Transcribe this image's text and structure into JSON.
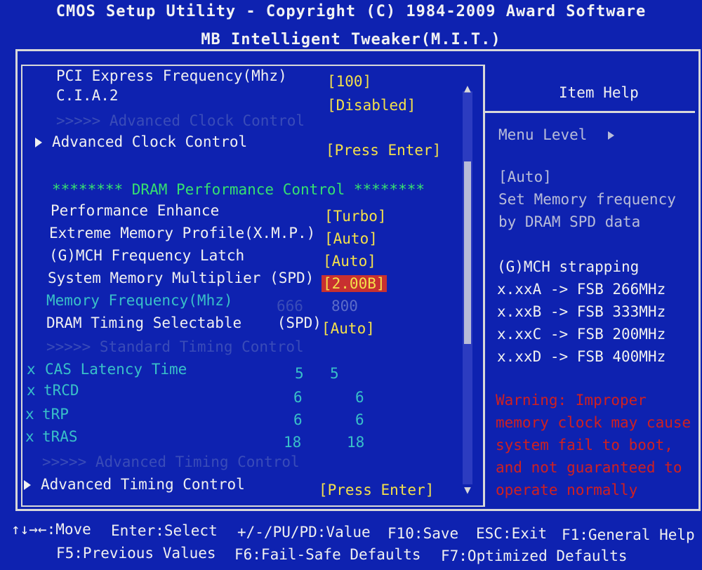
{
  "header": {
    "line1": "CMOS Setup Utility - Copyright (C) 1984-2009 Award Software",
    "line2": "MB Intelligent Tweaker(M.I.T.)"
  },
  "settings": {
    "pci_express_freq": {
      "label": "PCI Express Frequency(Mhz)",
      "value": "[100]"
    },
    "cia2": {
      "label": "C.I.A.2",
      "value": "[Disabled]"
    },
    "adv_clock_header": ">>>>> Advanced Clock Control",
    "adv_clock_control": {
      "label": "Advanced Clock Control",
      "value": "[Press Enter]"
    },
    "dram_section": "******** DRAM Performance Control ********",
    "performance_enhance": {
      "label": "Performance Enhance",
      "value": "[Turbo]"
    },
    "xmp": {
      "label": "Extreme Memory Profile(X.M.P.)",
      "value": "[Auto]"
    },
    "gmch_latch": {
      "label": "(G)MCH Frequency Latch",
      "value": "[Auto]"
    },
    "sys_mem_mult": {
      "label": "System Memory Multiplier (SPD)",
      "value": "[2.00B]"
    },
    "mem_freq": {
      "label": "Memory Frequency(Mhz)",
      "spd": "666",
      "value": "800"
    },
    "dram_timing": {
      "label": "DRAM Timing Selectable    (SPD)",
      "value": "[Auto]"
    },
    "std_timing_header": ">>>>> Standard Timing Control",
    "cas_latency": {
      "mark": "x",
      "label": "CAS Latency Time",
      "spd": "5",
      "value": "5"
    },
    "trcd": {
      "mark": "x",
      "label": "tRCD",
      "spd": "6",
      "value": "6"
    },
    "trp": {
      "mark": "x",
      "label": "tRP",
      "spd": "6",
      "value": "6"
    },
    "tras": {
      "mark": "x",
      "label": "tRAS",
      "spd": "18",
      "value": "18"
    },
    "adv_timing_header": ">>>>> Advanced Timing Control",
    "adv_timing_control": {
      "label": "Advanced Timing Control",
      "value": "[Press Enter]"
    }
  },
  "help": {
    "title": "Item Help",
    "menu_level": "Menu Level",
    "auto": "[Auto]",
    "desc1": "Set Memory frequency",
    "desc2": "by DRAM SPD data",
    "strap_title": "(G)MCH strapping",
    "strap1": "x.xxA -> FSB 266MHz",
    "strap2": "x.xxB -> FSB 333MHz",
    "strap3": "x.xxC -> FSB 200MHz",
    "strap4": "x.xxD -> FSB 400MHz",
    "warn1": "Warning: Improper",
    "warn2": "memory clock may cause",
    "warn3": "system fail to boot,",
    "warn4": "and not guaranteed to",
    "warn5": "operate normally"
  },
  "footer": {
    "move": "↑↓→←:Move",
    "select": "Enter:Select",
    "value": "+/-/PU/PD:Value",
    "save": "F10:Save",
    "exit": "ESC:Exit",
    "help": "F1:General Help",
    "prev": "F5:Previous Values",
    "failsafe": "F6:Fail-Safe Defaults",
    "optimized": "F7:Optimized Defaults"
  },
  "scroll": {
    "up": "▲",
    "down": "▼"
  }
}
